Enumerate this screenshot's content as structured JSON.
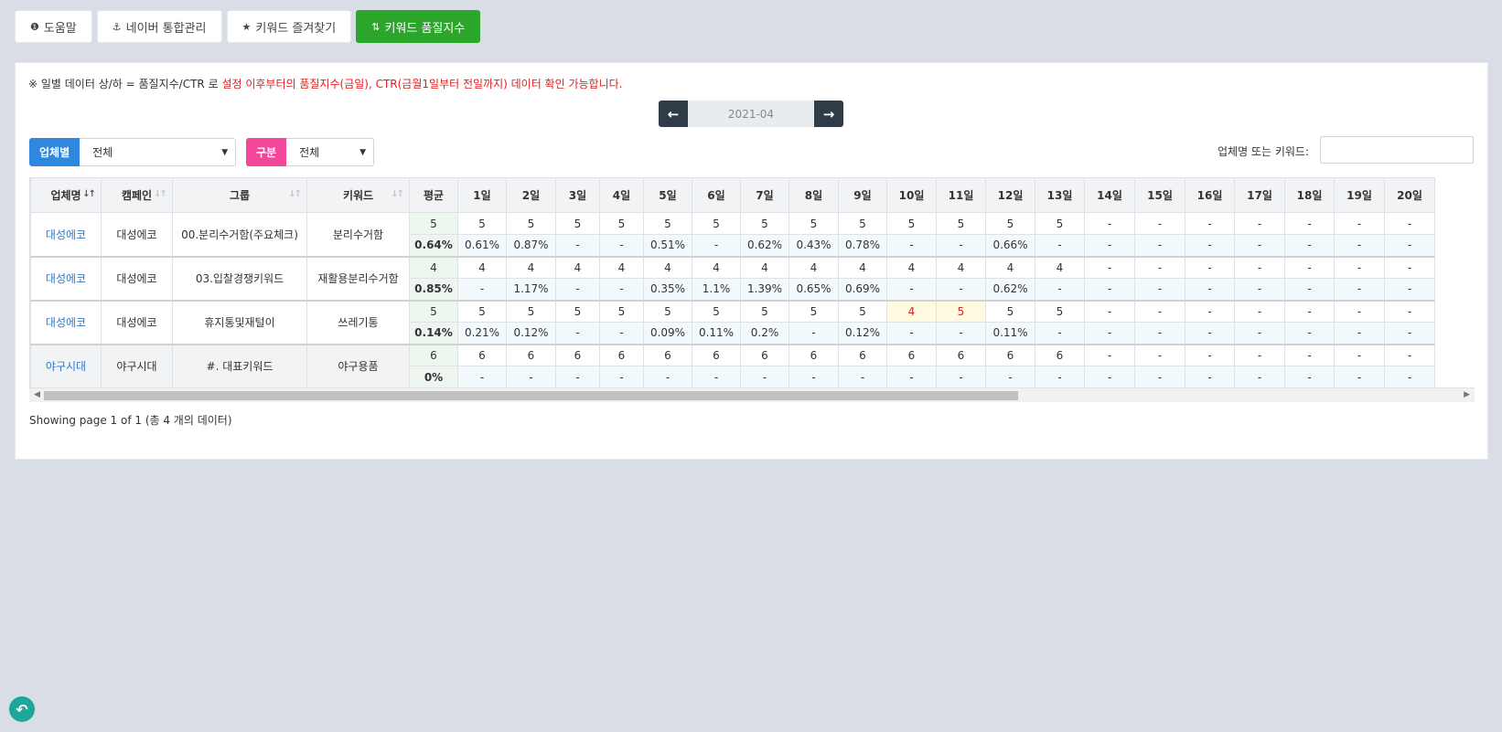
{
  "topbar": {
    "buttons": [
      {
        "icon": "info-icon",
        "glyph": "❶",
        "label": "도움말"
      },
      {
        "icon": "anchor-icon",
        "glyph": "⚓",
        "label": "네이버 통합관리"
      },
      {
        "icon": "star-icon",
        "glyph": "★",
        "label": "키워드 즐겨찾기"
      },
      {
        "icon": "sort-numeric-icon",
        "glyph": "⇅",
        "label": "키워드 품질지수"
      }
    ]
  },
  "notice": {
    "prefix": "※ 일별 데이터 상/하 = 품질지수/CTR 로 ",
    "highlight": "설정 이후부터의 품질지수(금일), CTR(금월1일부터 전일까지) 데이터 확인 가능합니다."
  },
  "month_nav": {
    "value": "2021-04",
    "prev_glyph": "🡐",
    "next_glyph": "🡒"
  },
  "filters": {
    "company": {
      "label": "업체별",
      "value": "전체",
      "color": "#2f87e0"
    },
    "category": {
      "label": "구분",
      "value": "전체",
      "color": "#f2479b"
    },
    "search_label": "업체명 또는 키워드:"
  },
  "table": {
    "headers": [
      "업체명",
      "캠페인",
      "그룹",
      "키워드",
      "평균",
      "1일",
      "2일",
      "3일",
      "4일",
      "5일",
      "6일",
      "7일",
      "8일",
      "9일",
      "10일",
      "11일",
      "12일",
      "13일",
      "14일",
      "15일",
      "16일",
      "17일",
      "18일",
      "19일",
      "20일"
    ],
    "rows": [
      {
        "company": "대성에코",
        "campaign": "대성에코",
        "group": "00.분리수거함(주요체크)",
        "keyword": "분리수거함",
        "quality_avg": "5",
        "ctr_avg": "0.64%",
        "quality": [
          "5",
          "5",
          "5",
          "5",
          "5",
          "5",
          "5",
          "5",
          "5",
          "5",
          "5",
          "5",
          "5",
          "-",
          "-",
          "-",
          "-",
          "-",
          "-",
          "-"
        ],
        "ctr": [
          "0.61%",
          "0.87%",
          "-",
          "-",
          "0.51%",
          "-",
          "0.62%",
          "0.43%",
          "0.78%",
          "-",
          "-",
          "0.66%",
          "-",
          "-",
          "-",
          "-",
          "-",
          "-",
          "-",
          "-"
        ]
      },
      {
        "company": "대성에코",
        "campaign": "대성에코",
        "group": "03.입찰경쟁키워드",
        "keyword": "재활용분리수거함",
        "quality_avg": "4",
        "ctr_avg": "0.85%",
        "quality": [
          "4",
          "4",
          "4",
          "4",
          "4",
          "4",
          "4",
          "4",
          "4",
          "4",
          "4",
          "4",
          "4",
          "-",
          "-",
          "-",
          "-",
          "-",
          "-",
          "-"
        ],
        "ctr": [
          "-",
          "1.17%",
          "-",
          "-",
          "0.35%",
          "1.1%",
          "1.39%",
          "0.65%",
          "0.69%",
          "-",
          "-",
          "0.62%",
          "-",
          "-",
          "-",
          "-",
          "-",
          "-",
          "-",
          "-"
        ]
      },
      {
        "company": "대성에코",
        "campaign": "대성에코",
        "group": "휴지통및재털이",
        "keyword": "쓰레기통",
        "quality_avg": "5",
        "ctr_avg": "0.14%",
        "quality": [
          "5",
          "5",
          "5",
          "5",
          "5",
          "5",
          "5",
          "5",
          "5",
          "4",
          "5",
          "5",
          "5",
          "-",
          "-",
          "-",
          "-",
          "-",
          "-",
          "-"
        ],
        "ctr": [
          "0.21%",
          "0.12%",
          "-",
          "-",
          "0.09%",
          "0.11%",
          "0.2%",
          "-",
          "0.12%",
          "-",
          "-",
          "0.11%",
          "-",
          "-",
          "-",
          "-",
          "-",
          "-",
          "-",
          "-"
        ],
        "highlight_days": [
          9,
          10
        ]
      },
      {
        "company": "야구시대",
        "campaign": "야구시대",
        "group": "#. 대표키워드",
        "keyword": "야구용품",
        "quality_avg": "6",
        "ctr_avg": "0%",
        "quality": [
          "6",
          "6",
          "6",
          "6",
          "6",
          "6",
          "6",
          "6",
          "6",
          "6",
          "6",
          "6",
          "6",
          "-",
          "-",
          "-",
          "-",
          "-",
          "-",
          "-"
        ],
        "ctr": [
          "-",
          "-",
          "-",
          "-",
          "-",
          "-",
          "-",
          "-",
          "-",
          "-",
          "-",
          "-",
          "-",
          "-",
          "-",
          "-",
          "-",
          "-",
          "-",
          "-"
        ]
      }
    ]
  },
  "footer": "Showing page 1 of 1 (총 4 개의 데이터)"
}
